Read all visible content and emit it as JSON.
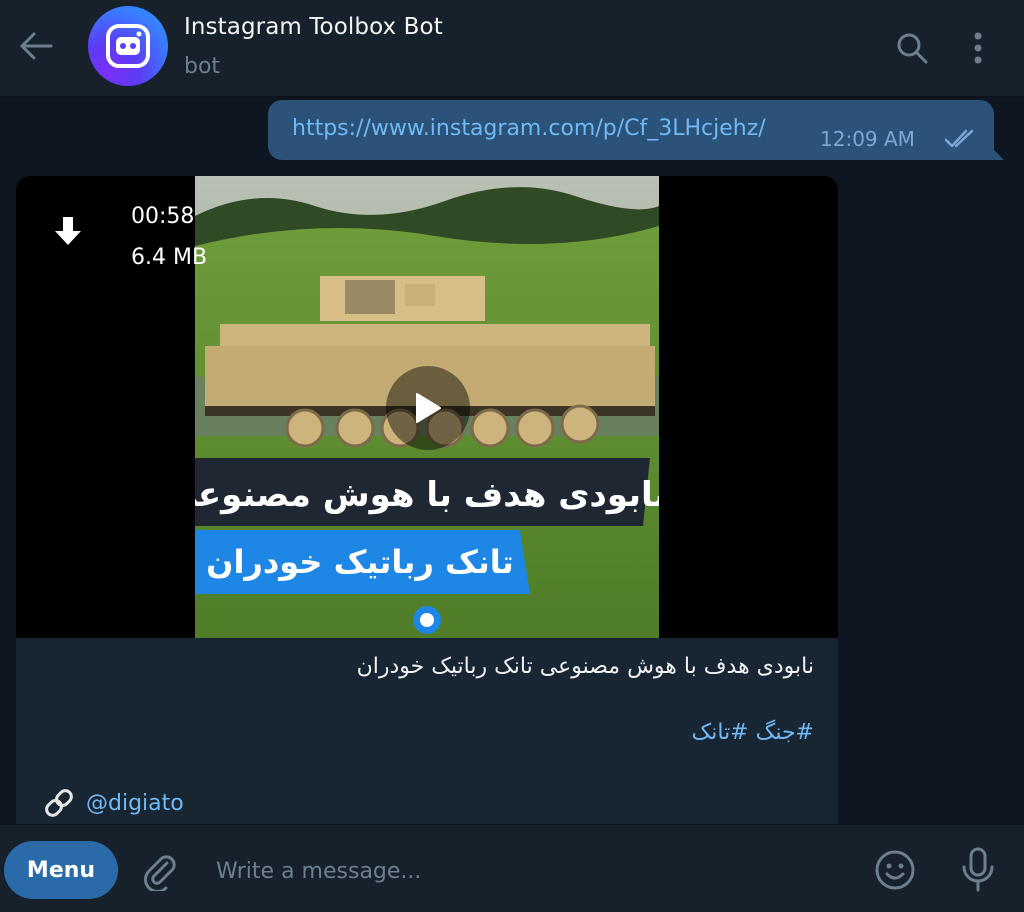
{
  "header": {
    "title": "Instagram Toolbox Bot",
    "subtitle": "bot",
    "icons": {
      "back": "arrow-left-icon",
      "avatar": "instagram-bot-avatar",
      "search": "search-icon",
      "more": "more-vertical-icon"
    }
  },
  "messages": {
    "outgoing": {
      "link": "https://www.instagram.com/p/Cf_3LHcjehz/",
      "time": "12:09 AM",
      "status": "read-double-check"
    },
    "incoming": {
      "video_duration": "00:58",
      "video_size": "6.4 MB",
      "overlay_text_line1": "نابودی هدف با هوش مصنوعی",
      "overlay_text_line2": "تانک رباتیک خودران",
      "caption": "نابودی هدف با هوش مصنوعی تانک رباتیک خودران",
      "hashtags": [
        "#جنگ",
        "#تانک"
      ],
      "via": "@digiato"
    }
  },
  "composer": {
    "menu_label": "Menu",
    "placeholder": "Write a message..."
  },
  "colors": {
    "background": "#0e1621",
    "panel": "#17212b",
    "outgoing_bubble": "#2b5278",
    "incoming_bubble": "#182533",
    "link": "#71b9f5",
    "menu_button": "#2b6aa8"
  }
}
